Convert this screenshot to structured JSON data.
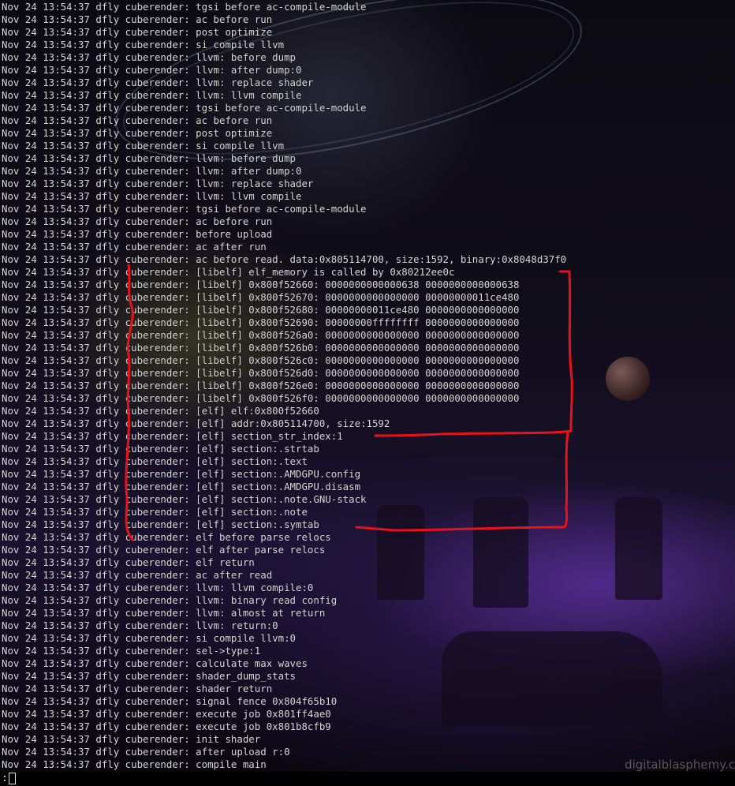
{
  "log_lines": [
    "Nov 24 13:54:37 dfly cuberender: tgsi before ac-compile-module",
    "Nov 24 13:54:37 dfly cuberender: ac before run",
    "Nov 24 13:54:37 dfly cuberender: post optimize",
    "Nov 24 13:54:37 dfly cuberender: si compile llvm",
    "Nov 24 13:54:37 dfly cuberender: llvm: before dump",
    "Nov 24 13:54:37 dfly cuberender: llvm: after dump:0",
    "Nov 24 13:54:37 dfly cuberender: llvm: replace shader",
    "Nov 24 13:54:37 dfly cuberender: llvm: llvm compile",
    "Nov 24 13:54:37 dfly cuberender: tgsi before ac-compile-module",
    "Nov 24 13:54:37 dfly cuberender: ac before run",
    "Nov 24 13:54:37 dfly cuberender: post optimize",
    "Nov 24 13:54:37 dfly cuberender: si compile llvm",
    "Nov 24 13:54:37 dfly cuberender: llvm: before dump",
    "Nov 24 13:54:37 dfly cuberender: llvm: after dump:0",
    "Nov 24 13:54:37 dfly cuberender: llvm: replace shader",
    "Nov 24 13:54:37 dfly cuberender: llvm: llvm compile",
    "Nov 24 13:54:37 dfly cuberender: tgsi before ac-compile-module",
    "Nov 24 13:54:37 dfly cuberender: ac before run",
    "Nov 24 13:54:37 dfly cuberender: before upload",
    "Nov 24 13:54:37 dfly cuberender: ac after run",
    "Nov 24 13:54:37 dfly cuberender: ac before read. data:0x805114700, size:1592, binary:0x8048d37f0",
    "Nov 24 13:54:37 dfly cuberender: [libelf] elf_memory is called by 0x80212ee0c",
    "Nov 24 13:54:37 dfly cuberender: [libelf] 0x800f52660: 0000000000000638 0000000000000638",
    "Nov 24 13:54:37 dfly cuberender: [libelf] 0x800f52670: 0000000000000000 00000000011ce480",
    "Nov 24 13:54:37 dfly cuberender: [libelf] 0x800f52680: 00000000011ce480 0000000000000000",
    "Nov 24 13:54:37 dfly cuberender: [libelf] 0x800f52690: 00000000ffffffff 0000000000000000",
    "Nov 24 13:54:37 dfly cuberender: [libelf] 0x800f526a0: 0000000000000000 0000000000000000",
    "Nov 24 13:54:37 dfly cuberender: [libelf] 0x800f526b0: 0000000000000000 0000000000000000",
    "Nov 24 13:54:37 dfly cuberender: [libelf] 0x800f526c0: 0000000000000000 0000000000000000",
    "Nov 24 13:54:37 dfly cuberender: [libelf] 0x800f526d0: 0000000000000000 0000000000000000",
    "Nov 24 13:54:37 dfly cuberender: [libelf] 0x800f526e0: 0000000000000000 0000000000000000",
    "Nov 24 13:54:37 dfly cuberender: [libelf] 0x800f526f0: 0000000000000000 0000000000000000",
    "Nov 24 13:54:37 dfly cuberender: [elf] elf:0x800f52660",
    "Nov 24 13:54:37 dfly cuberender: [elf] addr:0x805114700, size:1592",
    "Nov 24 13:54:37 dfly cuberender: [elf] section_str_index:1",
    "Nov 24 13:54:37 dfly cuberender: [elf] section:.strtab",
    "Nov 24 13:54:37 dfly cuberender: [elf] section:.text",
    "Nov 24 13:54:37 dfly cuberender: [elf] section:.AMDGPU.config",
    "Nov 24 13:54:37 dfly cuberender: [elf] section:.AMDGPU.disasm",
    "Nov 24 13:54:37 dfly cuberender: [elf] section:.note.GNU-stack",
    "Nov 24 13:54:37 dfly cuberender: [elf] section:.note",
    "Nov 24 13:54:37 dfly cuberender: [elf] section:.symtab",
    "Nov 24 13:54:37 dfly cuberender: elf before parse relocs",
    "Nov 24 13:54:37 dfly cuberender: elf after parse relocs",
    "Nov 24 13:54:37 dfly cuberender: elf return",
    "Nov 24 13:54:37 dfly cuberender: ac after read",
    "Nov 24 13:54:37 dfly cuberender: llvm: llvm compile:0",
    "Nov 24 13:54:37 dfly cuberender: llvm: binary read config",
    "Nov 24 13:54:37 dfly cuberender: llvm: almost at return",
    "Nov 24 13:54:37 dfly cuberender: llvm: return:0",
    "Nov 24 13:54:37 dfly cuberender: si compile llvm:0",
    "Nov 24 13:54:37 dfly cuberender: sel->type:1",
    "Nov 24 13:54:37 dfly cuberender: calculate max waves",
    "Nov 24 13:54:37 dfly cuberender: shader_dump_stats",
    "Nov 24 13:54:37 dfly cuberender: shader return",
    "Nov 24 13:54:37 dfly cuberender: signal fence 0x804f65b10",
    "Nov 24 13:54:37 dfly cuberender: execute job 0x801ff4ae0",
    "Nov 24 13:54:37 dfly cuberender: execute job 0x801b8cfb9",
    "Nov 24 13:54:37 dfly cuberender: init shader",
    "Nov 24 13:54:37 dfly cuberender: after upload r:0",
    "Nov 24 13:54:37 dfly cuberender: compile main"
  ],
  "prompt": ":",
  "watermark": "digitalblasphemy.c",
  "colors": {
    "annotation": "#e8121a",
    "text": "#d9d9d9"
  }
}
